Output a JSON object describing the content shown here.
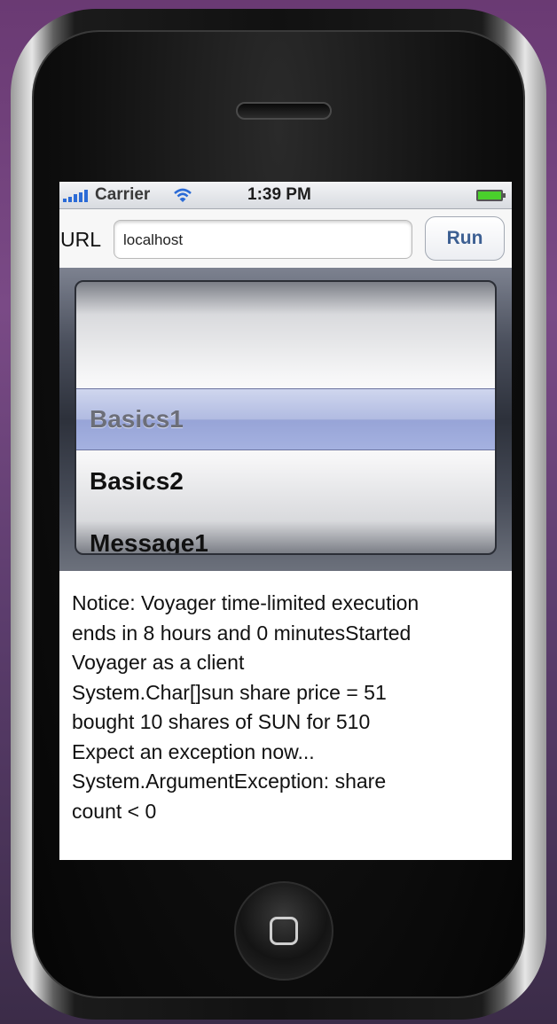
{
  "status_bar": {
    "carrier": "Carrier",
    "time": "1:39 PM",
    "signal_icon": "signal-bars-icon",
    "wifi_icon": "wifi-icon",
    "battery_icon": "battery-icon",
    "battery_color": "#4ad02c"
  },
  "url_bar": {
    "label": "URL",
    "value": "localhost",
    "run_label": "Run",
    "run_color": "#3c5f92"
  },
  "picker": {
    "items": [
      "Basics1",
      "Basics2",
      "Message1"
    ],
    "selected": "Basics1",
    "selection_color": "#a3afdc"
  },
  "output": {
    "lines": [
      "Notice: Voyager time-limited execution",
      "ends in 8 hours and 0 minutesStarted",
      "Voyager as a client",
      "System.Char[]sun share price = 51",
      "bought 10 shares of SUN for 510",
      "Expect an exception now...",
      "System.ArgumentException: share",
      "count < 0"
    ]
  },
  "device": {
    "speaker_icon": "speaker-grille-icon",
    "home_icon": "home-button-icon"
  }
}
